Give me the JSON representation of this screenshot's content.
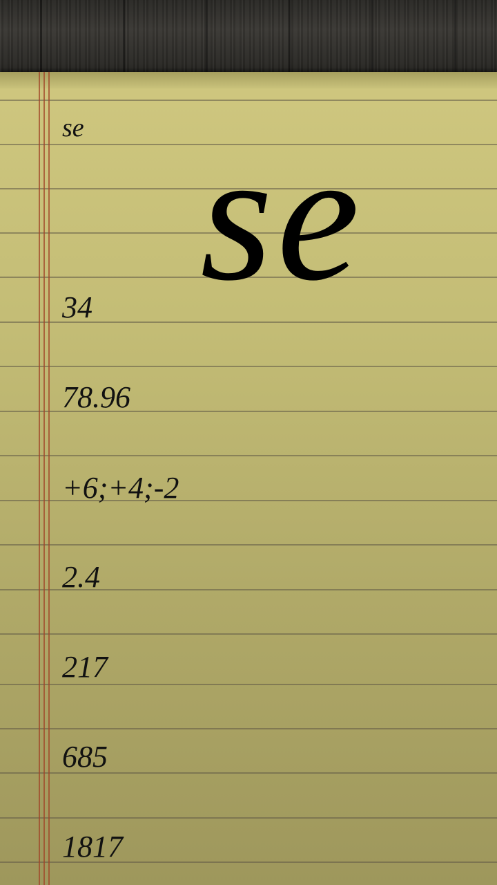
{
  "note": {
    "title_line": "se",
    "display_word": "se",
    "lines": [
      "34",
      "78.96",
      "+6;+4;-2",
      "2.4",
      "217",
      "685",
      "1817"
    ]
  },
  "colors": {
    "paper_top": "#cfc77f",
    "paper_bottom": "#9e975c",
    "rule_line": "#5f5846",
    "margin_line": "#a04628",
    "wood": "#2a2926",
    "ink": "#111111"
  }
}
